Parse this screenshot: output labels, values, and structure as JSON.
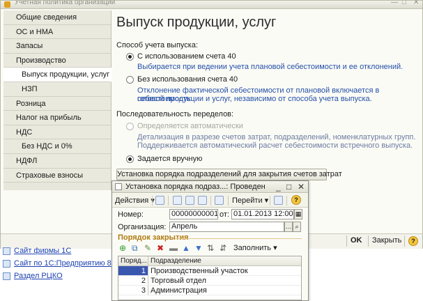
{
  "main_window": {
    "title": "Учетная политика организаций",
    "page_title": "Выпуск продукции, услуг"
  },
  "nav": {
    "items": [
      {
        "label": "Общие сведения"
      },
      {
        "label": "ОС и НМА"
      },
      {
        "label": "Запасы"
      },
      {
        "label": "Производство"
      },
      {
        "label": "Выпуск продукции, услуг"
      },
      {
        "label": "НЗП"
      },
      {
        "label": "Розница"
      },
      {
        "label": "Налог на прибыль"
      },
      {
        "label": "НДС"
      },
      {
        "label": "Без НДС и 0%"
      },
      {
        "label": "НДФЛ"
      },
      {
        "label": "Страховые взносы"
      }
    ]
  },
  "content": {
    "section1_label": "Способ учета выпуска:",
    "option1_label": "С использованием счета 40",
    "option1_hint": "Выбирается при ведении учета плановой себестоимости и ее отклонений.",
    "option2_label": "Без использования счета 40",
    "option2_hint_line1": "Отклонение фактической себестоимости от плановой включается в себестоимость",
    "option2_hint_line2": "готовой продукции и услуг, независимо от способа учета выпуска.",
    "section2_label": "Последовательность переделов:",
    "option3_label": "Определяется автоматически",
    "option3_hint_line1": "Детализация в разрезе счетов затрат, подразделений, номенклатурных групп.",
    "option3_hint_line2": "Поддерживается автоматический расчет себестоимости встречного выпуска.",
    "option4_label": "Задается вручную",
    "order_button_label": "Установка порядка подразделений для закрытия счетов затрат"
  },
  "main_bottom": {
    "ok_label": "OK",
    "close_label": "Закрыть",
    "help_label": "?"
  },
  "desktop_links": [
    {
      "label": "Сайт фирмы 1С"
    },
    {
      "label": "Сайт по 1С:Предприятию 8"
    },
    {
      "label": "Раздел РЦКО"
    }
  ],
  "popup": {
    "title": "Установка порядка подраз...: Проведен",
    "toolbar": {
      "actions_label": "Действия",
      "goto_label": "Перейти",
      "help_label": "?"
    },
    "number_label": "Номер:",
    "number_value": "00000000001",
    "date_label": "от:",
    "date_value": "01.01.2013 12:00:00",
    "org_label": "Организация:",
    "org_value": "Апрель",
    "group_title": "Порядок закрытия",
    "fill_label": "Заполнить",
    "table": {
      "headers": [
        "Поряд...",
        "Подразделение"
      ],
      "rows": [
        {
          "order": "1",
          "department": "Производственный участок"
        },
        {
          "order": "2",
          "department": "Торговый отдел"
        },
        {
          "order": "3",
          "department": "Администрация"
        }
      ]
    }
  }
}
